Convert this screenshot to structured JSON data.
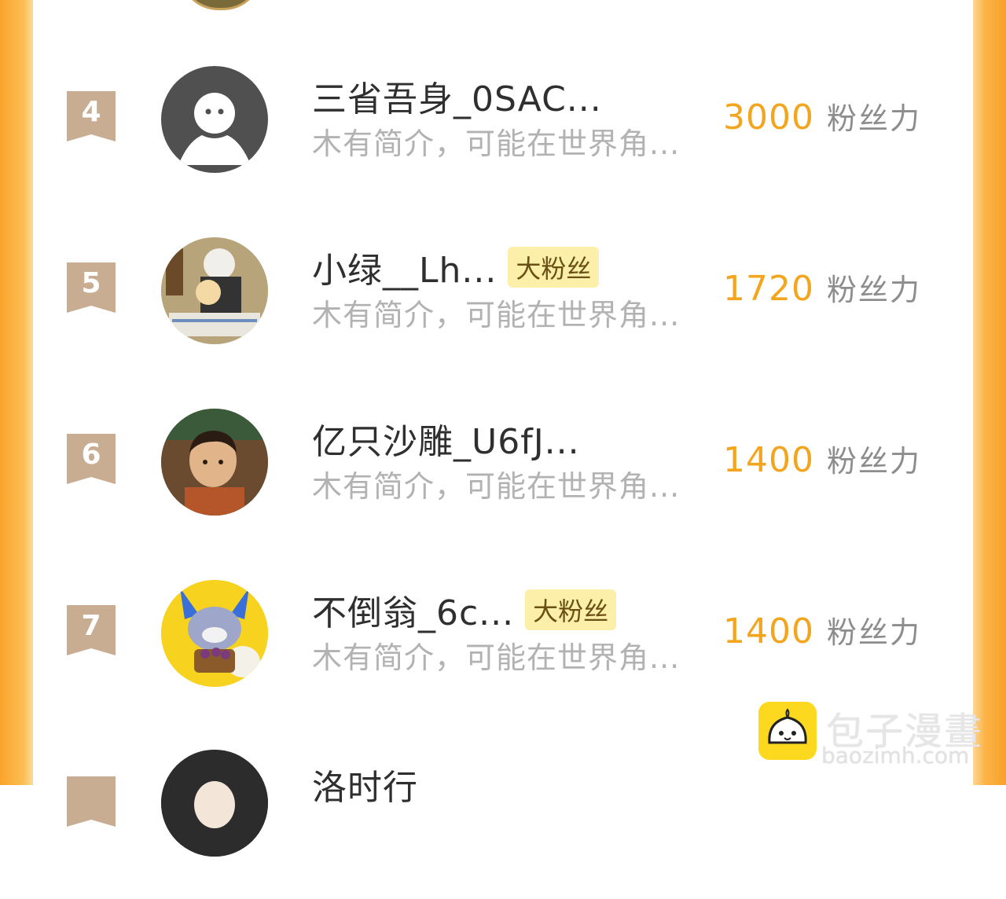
{
  "ranking": {
    "unit_label": "粉丝力",
    "items": [
      {
        "rank": "4",
        "name": "三省吾身_0SAC...",
        "tag": "",
        "bio": "木有简介，可能在世界角...",
        "score": "3000"
      },
      {
        "rank": "5",
        "name": "小绿__Lh...",
        "tag": "大粉丝",
        "bio": "木有简介，可能在世界角...",
        "score": "1720"
      },
      {
        "rank": "6",
        "name": "亿只沙雕_U6fJ...",
        "tag": "",
        "bio": "木有简介，可能在世界角...",
        "score": "1400"
      },
      {
        "rank": "7",
        "name": "不倒翁_6c...",
        "tag": "大粉丝",
        "bio": "木有简介，可能在世界角...",
        "score": "1400"
      },
      {
        "name": "洛时行"
      }
    ]
  },
  "watermark": {
    "title": "包子漫畫",
    "url": "baozimh.com"
  },
  "colors": {
    "accent_orange": "#f3a51d",
    "rank_badge": "#c9ad92",
    "tag_bg": "#fbefa9",
    "side_orange": "#fba42c"
  }
}
